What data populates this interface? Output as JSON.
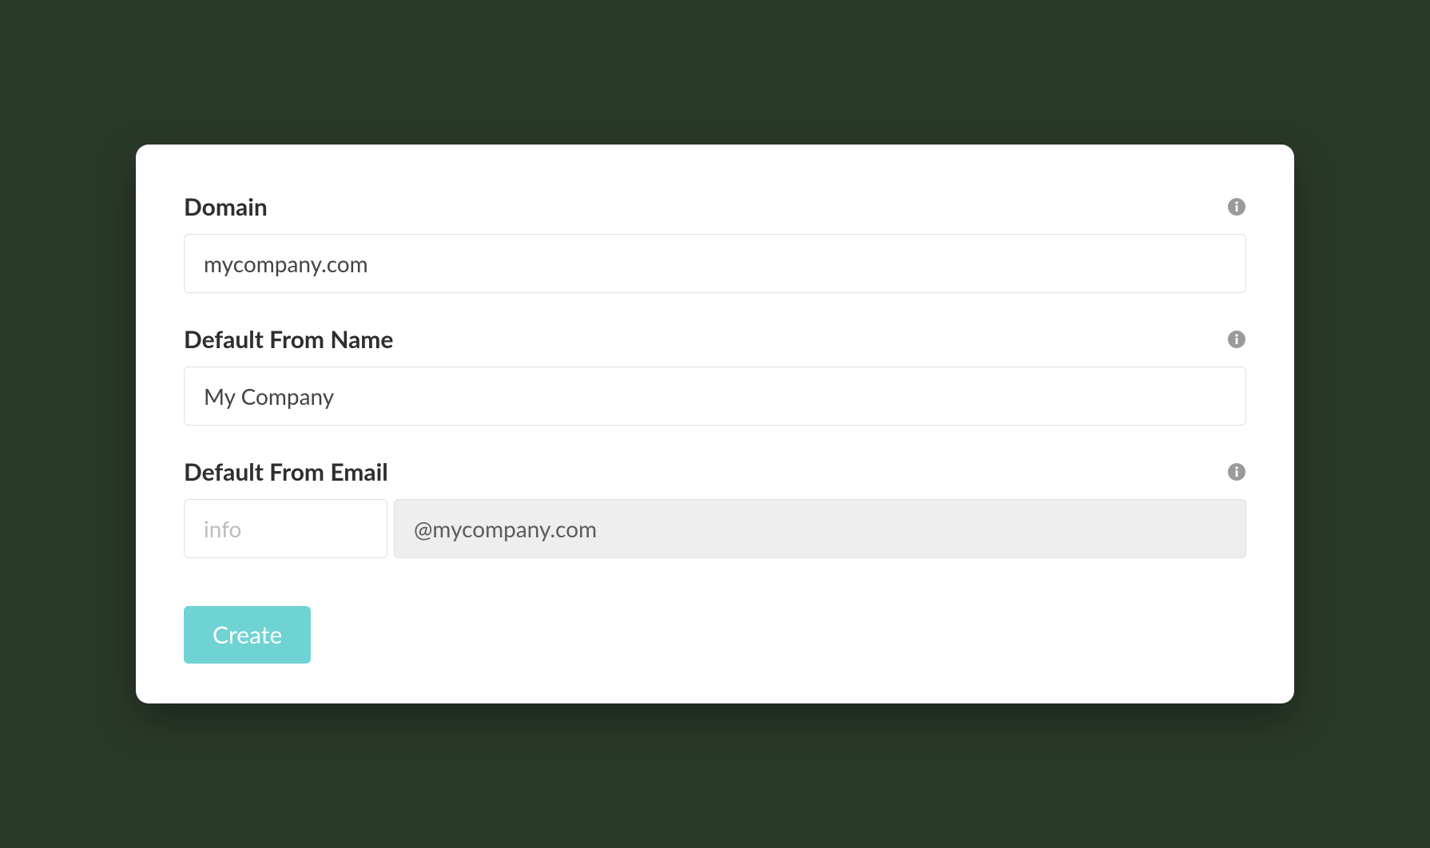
{
  "form": {
    "domain": {
      "label": "Domain",
      "value": "mycompany.com"
    },
    "from_name": {
      "label": "Default From Name",
      "value": "My Company"
    },
    "from_email": {
      "label": "Default From Email",
      "local_placeholder": "info",
      "local_value": "",
      "domain_suffix": "@mycompany.com"
    },
    "create_button": "Create"
  }
}
